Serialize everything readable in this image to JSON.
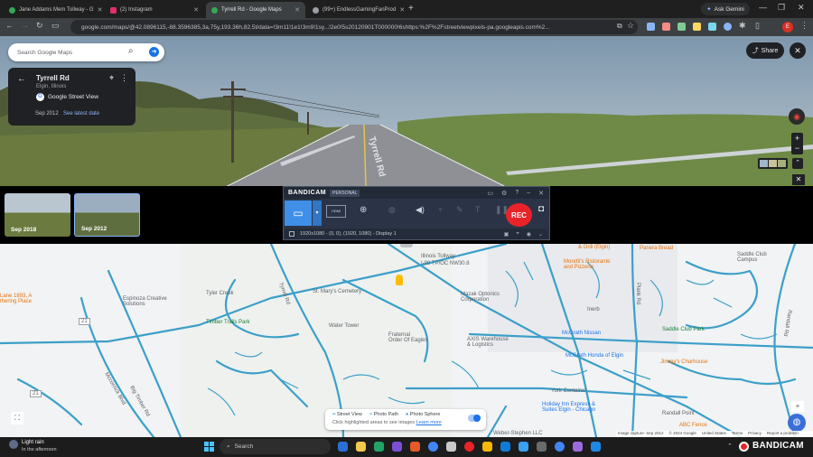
{
  "browser": {
    "tabs": [
      {
        "title": "Jane Addams Mem Tollway - G",
        "color": "#34a853",
        "active": false
      },
      {
        "title": "(2) Instagram",
        "color": "#e1306c",
        "active": false
      },
      {
        "title": "Tyrrell Rd - Google Maps",
        "color": "#34a853",
        "active": true
      },
      {
        "title": "(99+) EndlessGamingFanProd",
        "color": "#9aa0a6",
        "active": false
      }
    ],
    "new_tab": "+",
    "ask_gemini": "Ask Gemini",
    "url": "google.com/maps/@42.0896115,-88.3596385,3a,75y,193.36h,82.5t/data=!3m11!1e1!3m9!1sy...!2e0!5s20120901T000000!6shttps:%2F%2Fstreetviewpixels-pa.googleapis.com%2..."
  },
  "search": {
    "placeholder": "Search Google Maps"
  },
  "place_card": {
    "title": "Tyrrell Rd",
    "subtitle": "Elgin, Illinois",
    "source": "Google Street View",
    "date": "Sep 2012",
    "latest_link": "See latest date"
  },
  "street_view": {
    "share_label": "Share",
    "road_sign": "Tyrrell Rd",
    "timeline": [
      {
        "label": "Sep 2018"
      },
      {
        "label": "Sep 2012"
      }
    ]
  },
  "bandicam": {
    "logo": "BANDICAM",
    "edition": "PERSONAL",
    "rec_label": "REC",
    "status": "1920x1080 - (0, 0), (1920, 1080) - Display 1",
    "hdmi": "HDMI"
  },
  "map_labels": {
    "oak_creek": "Tyler Creek",
    "espinoza": "Espinoza Creative\nSolutions",
    "lb1893": "Lane 1893, A\nthering Place",
    "st_marys": "St. Mary's Cemetery",
    "timber_trails": "Timber Trails Park",
    "water_tower": "Water Tower",
    "fraternal": "Fraternal\nOrder Of Eagles",
    "mazak": "Mazak Optonics\nCorporation",
    "axis": "AXIS Warehouse\n& Logistics",
    "i90": "I-90 TP/OC NW30.8",
    "illinois_tollway": "Illinois Tollway",
    "moretti": "Moretti's Ristorante\nand Pizzeria",
    "panera": "Panera Bread",
    "saddle": "Saddle Club\nCampus",
    "saddle_park": "Saddle Club Park",
    "mcgrath_nissan": "McGrath Nissan",
    "mcgrath_honda": "McGrath Honda of Elgin",
    "jimmy": "Jimmy's Charhouse",
    "york_container": "York Container",
    "holiday_inn": "Holiday Inn Express &\nSuites Elgin - Chicago",
    "weber": "Weber-Stephen LLC",
    "randall": "Randall Point",
    "abc_fence": "ABC Fence",
    "inerb": "Inerb",
    "grill": "& Grill (Elgin)",
    "route_21a": "21",
    "route_21b": "21",
    "big_timber": "Big Timber Rd",
    "mccornick": "Mccornick Blvd",
    "tyrrell_map": "Tyrrell Rd",
    "plank_rd": "Plank Rd",
    "randall_rd": "Randall Rd"
  },
  "legend": {
    "street_view": "Street View",
    "photo_path": "Photo Path",
    "photo_sphere": "Photo Sphere",
    "hint": "Click highlighted areas to see images",
    "learn_more": "Learn more"
  },
  "attribution": {
    "capture": "Image capture: Sep 2012",
    "copyright": "© 2024 Google",
    "region": "United States",
    "terms": "Terms",
    "privacy": "Privacy",
    "report": "Report a problem"
  },
  "taskbar": {
    "weather_title": "Light rain",
    "weather_sub": "In the afternoon",
    "search_label": "Search",
    "bandicam_brand": "BANDICAM"
  },
  "colors": {
    "accent": "#1a73e8",
    "map_road": "#3c9fc9",
    "rec": "#e8232a"
  }
}
